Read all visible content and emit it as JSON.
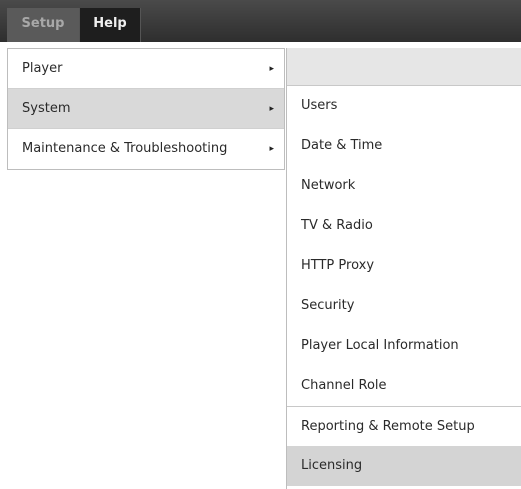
{
  "menubar": {
    "items": [
      {
        "label": "Setup"
      },
      {
        "label": "Help"
      }
    ]
  },
  "dropdown": {
    "items": [
      {
        "label": "Player",
        "arrow": "▸"
      },
      {
        "label": "System",
        "arrow": "▸"
      },
      {
        "label": "Maintenance & Troubleshooting",
        "arrow": "▸"
      }
    ],
    "active_index": 1
  },
  "submenu": {
    "items": [
      {
        "label": "Users"
      },
      {
        "label": "Date & Time"
      },
      {
        "label": "Network"
      },
      {
        "label": "TV & Radio"
      },
      {
        "label": "HTTP Proxy"
      },
      {
        "label": "Security"
      },
      {
        "label": "Player Local Information"
      },
      {
        "label": "Channel Role"
      },
      {
        "label": "Reporting & Remote Setup"
      },
      {
        "label": "Licensing"
      }
    ],
    "selected_index": 9
  },
  "icons": {
    "submenu_arrow": "triangle-right-icon"
  }
}
